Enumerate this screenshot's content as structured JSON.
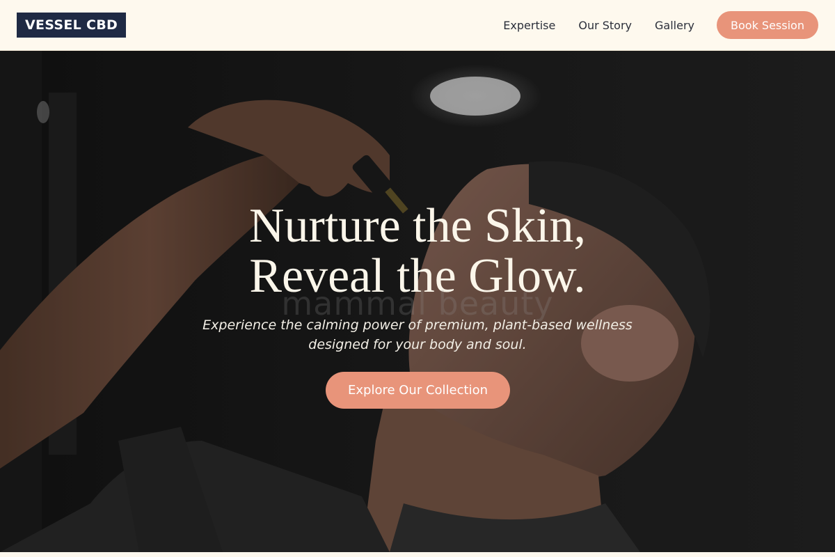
{
  "brand": {
    "logo": "VESSEL CBD"
  },
  "nav": {
    "links": [
      "Expertise",
      "Our Story",
      "Gallery"
    ],
    "cta_label": "Book Session"
  },
  "hero": {
    "headline_line1": "Nurture the Skin,",
    "headline_line2": "Reveal the Glow.",
    "watermark": "mammal beauty",
    "subtext_line1": "Experience the calming power of premium, plant-based wellness",
    "subtext_line2": "designed for your body and soul.",
    "cta_label": "Explore Our Collection",
    "image_description": "man applying CBD oil dropper"
  },
  "colors": {
    "accent": "#e8947a",
    "nav_bg": "#fef9ee",
    "logo_bg": "#1f2a44",
    "hero_text": "#fbf6ea"
  }
}
